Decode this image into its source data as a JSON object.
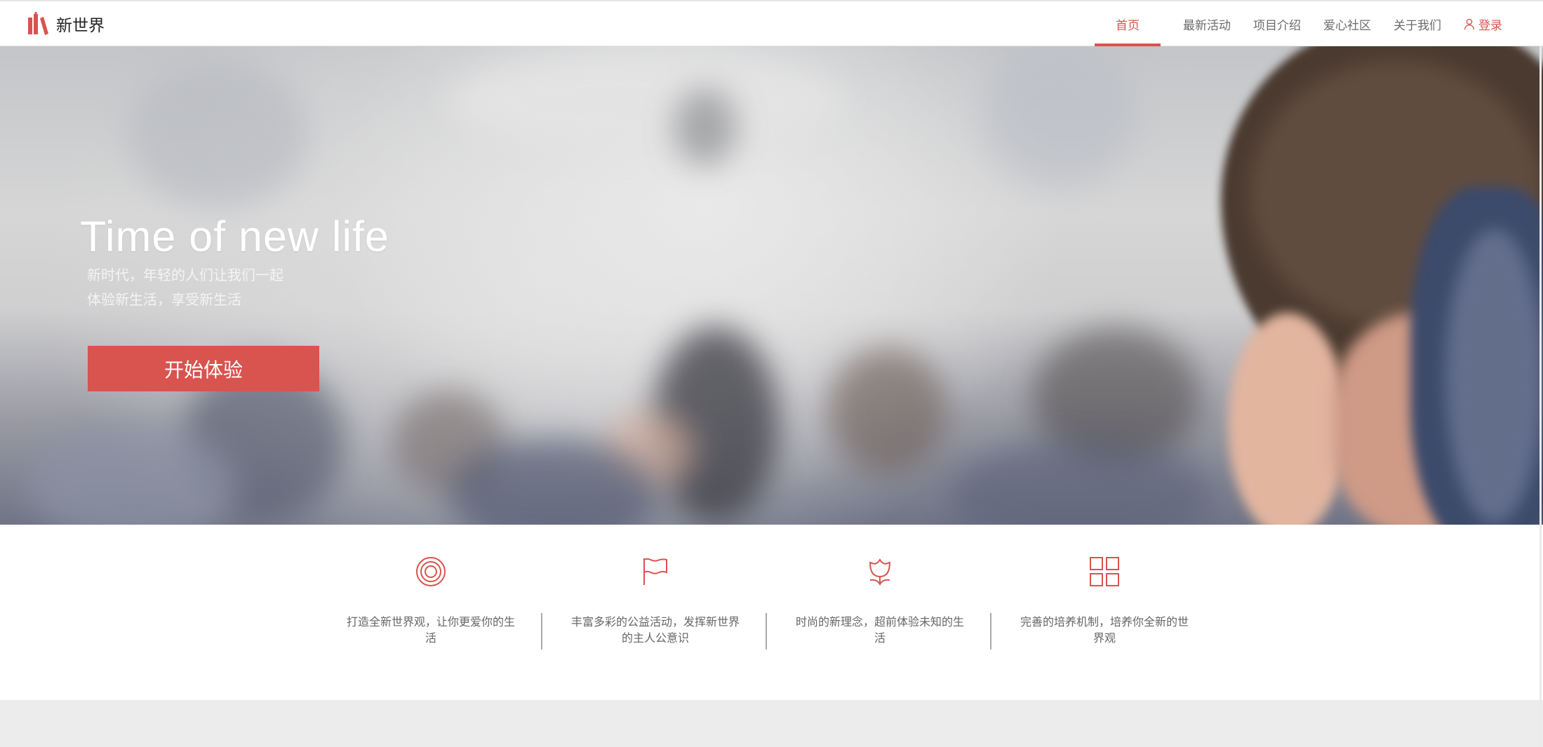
{
  "brand": {
    "name": "新世界"
  },
  "nav": {
    "items": [
      "首页",
      "最新活动",
      "项目介绍",
      "爱心社区",
      "关于我们"
    ],
    "login_label": "登录"
  },
  "hero": {
    "title": "Time of new life",
    "line1": "新时代，年轻的人们让我们一起",
    "line2": "体验新生活，享受新生活",
    "cta_label": "开始体验"
  },
  "features": [
    {
      "icon": "target-icon",
      "text": "打造全新世界观，让你更爱你的生活"
    },
    {
      "icon": "flag-icon",
      "text": "丰富多彩的公益活动，发挥新世界的主人公意识"
    },
    {
      "icon": "flower-icon",
      "text": "时尚的新理念，超前体验未知的生活"
    },
    {
      "icon": "grid-icon",
      "text": "完善的培养机制，培养你全新的世界观"
    }
  ],
  "colors": {
    "accent": "#d9534f",
    "nav_text": "#6b6b6b",
    "footer_band": "#ececec"
  }
}
